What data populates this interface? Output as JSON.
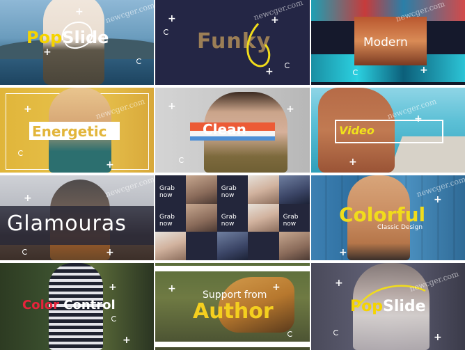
{
  "tiles": [
    {
      "id": "popslide",
      "title_a": "Pop",
      "title_b": "Slide"
    },
    {
      "id": "funky",
      "title": "Funky"
    },
    {
      "id": "modern",
      "title": "Modern"
    },
    {
      "id": "energetic",
      "title": "Energetic"
    },
    {
      "id": "clean",
      "title": "Clean"
    },
    {
      "id": "video",
      "title": "Video"
    },
    {
      "id": "glamouras",
      "title": "Glamouras"
    },
    {
      "id": "grab-now",
      "labels": [
        "Grab now",
        "Grab now",
        "Grab now",
        "Grab now",
        "Grab now"
      ]
    },
    {
      "id": "colorful",
      "title": "Colorful",
      "subtitle": "Classic Design"
    },
    {
      "id": "color-control",
      "title_a": "Color",
      "title_b": "Control"
    },
    {
      "id": "support-author",
      "title_line1": "Support from",
      "title_line2": "Author"
    },
    {
      "id": "popslide-2",
      "title_a": "Pop",
      "title_b": "Slide"
    }
  ],
  "watermark": "newcger.com",
  "colors": {
    "yellow_accent": "#f5d400",
    "red_accent": "#e8233b",
    "clean_orange": "#ec5b36",
    "clean_blue": "#4d8fd6",
    "funky_brown": "#9b7e56"
  }
}
